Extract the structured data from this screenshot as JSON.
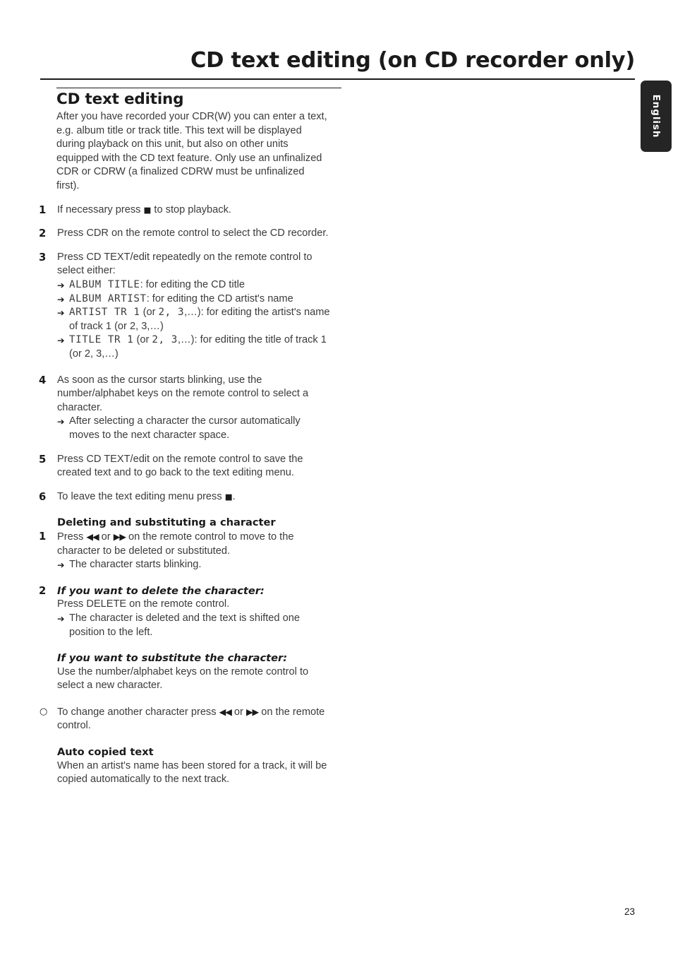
{
  "page": {
    "title": "CD text editing (on CD recorder only)",
    "number": "23",
    "language_tab": "English"
  },
  "section": {
    "heading": "CD text editing",
    "intro": "After you have recorded your CDR(W) you can enter a text, e.g. album title or track title. This text will be displayed during playback on this unit, but also on other units equipped with the CD text feature. Only use an unfinalized CDR or CDRW (a finalized CDRW must be unfinalized first)."
  },
  "steps": {
    "s1_num": "1",
    "s1_pre": "If necessary press",
    "s1_glyph": "■",
    "s1_post": "to stop playback.",
    "s2_num": "2",
    "s2_text": "Press CDR on the remote control to select the CD recorder.",
    "s3_num": "3",
    "s3_text": "Press CD TEXT/edit repeatedly on the remote control to select either:",
    "s3_items": [
      {
        "arrow": "➔",
        "lcd": "ALBUM TITLE",
        "rest": ": for editing the CD title"
      },
      {
        "arrow": "➔",
        "lcd": "ALBUM ARTIST",
        "rest": ": for editing the CD artist's name"
      },
      {
        "arrow": "➔",
        "lcd": "ARTIST TR  1",
        "mid": " (or ",
        "lcd2": "2, 3",
        "rest": ",…): for editing the artist's name of track 1 (or 2, 3,…)"
      },
      {
        "arrow": "➔",
        "lcd": "TITLE TR  1",
        "mid": " (or ",
        "lcd2": "2, 3",
        "rest": ",…): for editing the title of track 1 (or 2, 3,…)"
      }
    ],
    "s4_num": "4",
    "s4_text": "As soon as the cursor starts blinking, use the number/alphabet keys on the remote control to select a character.",
    "s4_arrow": "➔",
    "s4_sub": "After selecting a character the cursor automatically moves to the next character space.",
    "s5_num": "5",
    "s5_text": "Press CD TEXT/edit on the remote control to save the created text and to go back to the text editing menu.",
    "s6_num": "6",
    "s6_pre": "To leave the text editing menu press",
    "s6_glyph": "■",
    "s6_post": "."
  },
  "deleting": {
    "heading": "Deleting and substituting a character",
    "d1_num": "1",
    "d1_pre": "Press",
    "d1_rew": "◀◀",
    "d1_or": "or",
    "d1_ff": "▶▶",
    "d1_post": "on the remote control to move to the character to be deleted or substituted.",
    "d1_arrow": "➔",
    "d1_sub": "The character starts blinking.",
    "d2_num": "2",
    "d2_head": "If you want to delete the character:",
    "d2_text": "Press DELETE on the remote control.",
    "d2_arrow": "➔",
    "d2_sub": "The character is deleted and the text is shifted one position to the left.",
    "d3_head": "If you want to substitute the character:",
    "d3_text": "Use the number/alphabet keys on the remote control to select a new character.",
    "d4_bullet": "○",
    "d4_pre": "To change another character press",
    "d4_rew": "◀◀",
    "d4_or": "or",
    "d4_ff": "▶▶",
    "d4_post": "on the remote control."
  },
  "auto_copy": {
    "heading": "Auto copied text",
    "text": "When an artist's name has been stored for a track, it will be copied automatically to the next track."
  }
}
